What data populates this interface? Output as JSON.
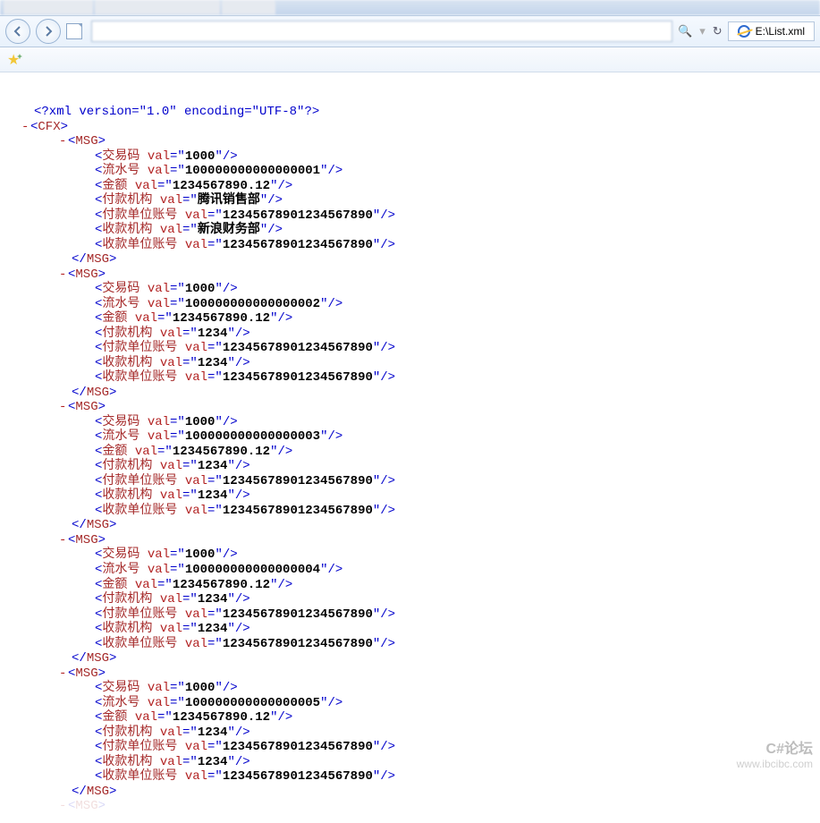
{
  "browser": {
    "path_label": "E:\\List.xml",
    "search_icon_glyph": "",
    "refresh_icon_glyph": "↻"
  },
  "xml": {
    "prolog": "<?xml version=\"1.0\" encoding=\"UTF-8\"?>",
    "root": "CFX",
    "msg_tag": "MSG",
    "attr_name": "val",
    "fields": [
      "交易码",
      "流水号",
      "金额",
      "付款机构",
      "付款单位账号",
      "收款机构",
      "收款单位账号"
    ],
    "records": [
      {
        "交易码": "1000",
        "流水号": "100000000000000001",
        "金额": "1234567890.12",
        "付款机构": "腾讯销售部",
        "付款单位账号": "12345678901234567890",
        "收款机构": "新浪财务部",
        "收款单位账号": "12345678901234567890"
      },
      {
        "交易码": "1000",
        "流水号": "100000000000000002",
        "金额": "1234567890.12",
        "付款机构": "1234",
        "付款单位账号": "12345678901234567890",
        "收款机构": "1234",
        "收款单位账号": "12345678901234567890"
      },
      {
        "交易码": "1000",
        "流水号": "100000000000000003",
        "金额": "1234567890.12",
        "付款机构": "1234",
        "付款单位账号": "12345678901234567890",
        "收款机构": "1234",
        "收款单位账号": "12345678901234567890"
      },
      {
        "交易码": "1000",
        "流水号": "100000000000000004",
        "金额": "1234567890.12",
        "付款机构": "1234",
        "付款单位账号": "12345678901234567890",
        "收款机构": "1234",
        "收款单位账号": "12345678901234567890"
      },
      {
        "交易码": "1000",
        "流水号": "100000000000000005",
        "金额": "1234567890.12",
        "付款机构": "1234",
        "付款单位账号": "12345678901234567890",
        "收款机构": "1234",
        "收款单位账号": "12345678901234567890"
      }
    ]
  },
  "watermark": {
    "line1": "C#论坛",
    "line2": "www.ibcibc.com"
  }
}
